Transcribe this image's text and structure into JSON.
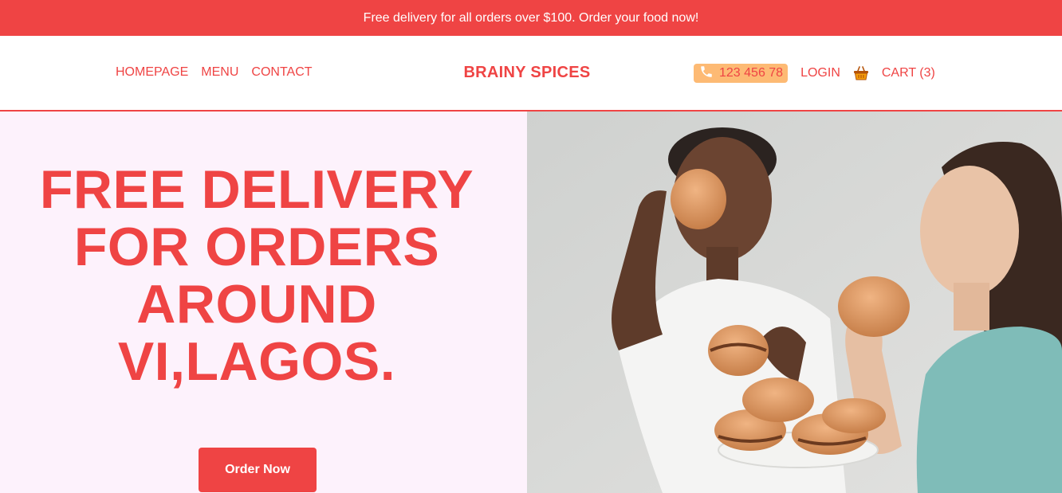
{
  "promo": {
    "text": "Free delivery for all orders over $100. Order your food now!"
  },
  "nav": {
    "links": [
      "HOMEPAGE",
      "MENU",
      "CONTACT"
    ],
    "brand": "BRAINY SPICES",
    "phone": "123 456 78",
    "login": "LOGIN",
    "cart": "CART (3)"
  },
  "hero": {
    "heading_lines": [
      "FREE DELIVERY",
      "FOR ORDERS",
      "AROUND",
      "VI,LAGOS."
    ],
    "cta": "Order Now"
  },
  "colors": {
    "brand_red": "#ef4444",
    "phone_pill": "#fdba74",
    "hero_bg": "#fdf2fc"
  },
  "icons": {
    "phone": "phone-icon",
    "cart": "shopping-basket-icon"
  }
}
